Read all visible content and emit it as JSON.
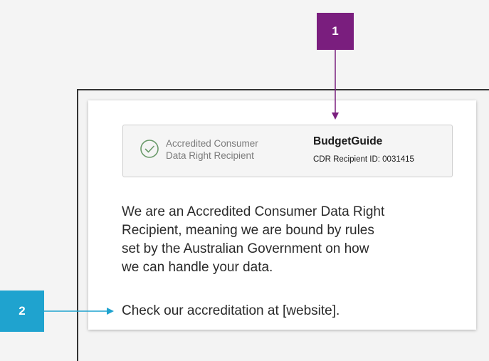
{
  "markers": [
    {
      "label": "1",
      "color": "#7a1e7e"
    },
    {
      "label": "2",
      "color": "#1fa3cf"
    }
  ],
  "badge": {
    "accredited_lines": [
      "Accredited Consumer",
      "Data Right Recipient"
    ],
    "brand_name": "BudgetGuide",
    "recipient_id_label": "CDR Recipient ID:",
    "recipient_id_value": "0031415",
    "icon": "check-circle-icon"
  },
  "body": {
    "lines": [
      "We are an Accredited Consumer Data Right",
      "Recipient, meaning we are bound by rules",
      "set by the Australian Government on how",
      "we can handle your data."
    ],
    "check_link": "Check our accreditation at [website]."
  }
}
